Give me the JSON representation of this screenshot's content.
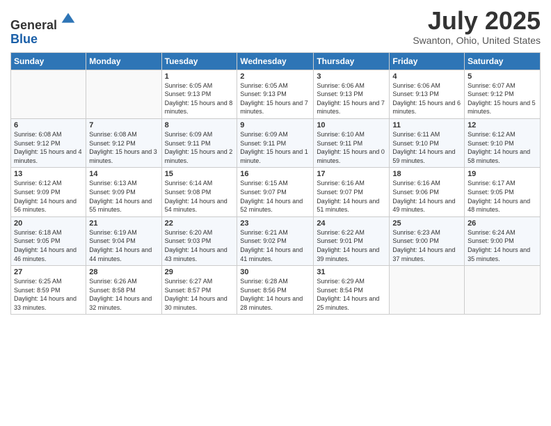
{
  "header": {
    "logo_line1": "General",
    "logo_line2": "Blue",
    "month_title": "July 2025",
    "location": "Swanton, Ohio, United States"
  },
  "weekdays": [
    "Sunday",
    "Monday",
    "Tuesday",
    "Wednesday",
    "Thursday",
    "Friday",
    "Saturday"
  ],
  "weeks": [
    [
      {
        "day": "",
        "info": ""
      },
      {
        "day": "",
        "info": ""
      },
      {
        "day": "1",
        "info": "Sunrise: 6:05 AM\nSunset: 9:13 PM\nDaylight: 15 hours and 8 minutes."
      },
      {
        "day": "2",
        "info": "Sunrise: 6:05 AM\nSunset: 9:13 PM\nDaylight: 15 hours and 7 minutes."
      },
      {
        "day": "3",
        "info": "Sunrise: 6:06 AM\nSunset: 9:13 PM\nDaylight: 15 hours and 7 minutes."
      },
      {
        "day": "4",
        "info": "Sunrise: 6:06 AM\nSunset: 9:13 PM\nDaylight: 15 hours and 6 minutes."
      },
      {
        "day": "5",
        "info": "Sunrise: 6:07 AM\nSunset: 9:12 PM\nDaylight: 15 hours and 5 minutes."
      }
    ],
    [
      {
        "day": "6",
        "info": "Sunrise: 6:08 AM\nSunset: 9:12 PM\nDaylight: 15 hours and 4 minutes."
      },
      {
        "day": "7",
        "info": "Sunrise: 6:08 AM\nSunset: 9:12 PM\nDaylight: 15 hours and 3 minutes."
      },
      {
        "day": "8",
        "info": "Sunrise: 6:09 AM\nSunset: 9:11 PM\nDaylight: 15 hours and 2 minutes."
      },
      {
        "day": "9",
        "info": "Sunrise: 6:09 AM\nSunset: 9:11 PM\nDaylight: 15 hours and 1 minute."
      },
      {
        "day": "10",
        "info": "Sunrise: 6:10 AM\nSunset: 9:11 PM\nDaylight: 15 hours and 0 minutes."
      },
      {
        "day": "11",
        "info": "Sunrise: 6:11 AM\nSunset: 9:10 PM\nDaylight: 14 hours and 59 minutes."
      },
      {
        "day": "12",
        "info": "Sunrise: 6:12 AM\nSunset: 9:10 PM\nDaylight: 14 hours and 58 minutes."
      }
    ],
    [
      {
        "day": "13",
        "info": "Sunrise: 6:12 AM\nSunset: 9:09 PM\nDaylight: 14 hours and 56 minutes."
      },
      {
        "day": "14",
        "info": "Sunrise: 6:13 AM\nSunset: 9:09 PM\nDaylight: 14 hours and 55 minutes."
      },
      {
        "day": "15",
        "info": "Sunrise: 6:14 AM\nSunset: 9:08 PM\nDaylight: 14 hours and 54 minutes."
      },
      {
        "day": "16",
        "info": "Sunrise: 6:15 AM\nSunset: 9:07 PM\nDaylight: 14 hours and 52 minutes."
      },
      {
        "day": "17",
        "info": "Sunrise: 6:16 AM\nSunset: 9:07 PM\nDaylight: 14 hours and 51 minutes."
      },
      {
        "day": "18",
        "info": "Sunrise: 6:16 AM\nSunset: 9:06 PM\nDaylight: 14 hours and 49 minutes."
      },
      {
        "day": "19",
        "info": "Sunrise: 6:17 AM\nSunset: 9:05 PM\nDaylight: 14 hours and 48 minutes."
      }
    ],
    [
      {
        "day": "20",
        "info": "Sunrise: 6:18 AM\nSunset: 9:05 PM\nDaylight: 14 hours and 46 minutes."
      },
      {
        "day": "21",
        "info": "Sunrise: 6:19 AM\nSunset: 9:04 PM\nDaylight: 14 hours and 44 minutes."
      },
      {
        "day": "22",
        "info": "Sunrise: 6:20 AM\nSunset: 9:03 PM\nDaylight: 14 hours and 43 minutes."
      },
      {
        "day": "23",
        "info": "Sunrise: 6:21 AM\nSunset: 9:02 PM\nDaylight: 14 hours and 41 minutes."
      },
      {
        "day": "24",
        "info": "Sunrise: 6:22 AM\nSunset: 9:01 PM\nDaylight: 14 hours and 39 minutes."
      },
      {
        "day": "25",
        "info": "Sunrise: 6:23 AM\nSunset: 9:00 PM\nDaylight: 14 hours and 37 minutes."
      },
      {
        "day": "26",
        "info": "Sunrise: 6:24 AM\nSunset: 9:00 PM\nDaylight: 14 hours and 35 minutes."
      }
    ],
    [
      {
        "day": "27",
        "info": "Sunrise: 6:25 AM\nSunset: 8:59 PM\nDaylight: 14 hours and 33 minutes."
      },
      {
        "day": "28",
        "info": "Sunrise: 6:26 AM\nSunset: 8:58 PM\nDaylight: 14 hours and 32 minutes."
      },
      {
        "day": "29",
        "info": "Sunrise: 6:27 AM\nSunset: 8:57 PM\nDaylight: 14 hours and 30 minutes."
      },
      {
        "day": "30",
        "info": "Sunrise: 6:28 AM\nSunset: 8:56 PM\nDaylight: 14 hours and 28 minutes."
      },
      {
        "day": "31",
        "info": "Sunrise: 6:29 AM\nSunset: 8:54 PM\nDaylight: 14 hours and 25 minutes."
      },
      {
        "day": "",
        "info": ""
      },
      {
        "day": "",
        "info": ""
      }
    ]
  ]
}
